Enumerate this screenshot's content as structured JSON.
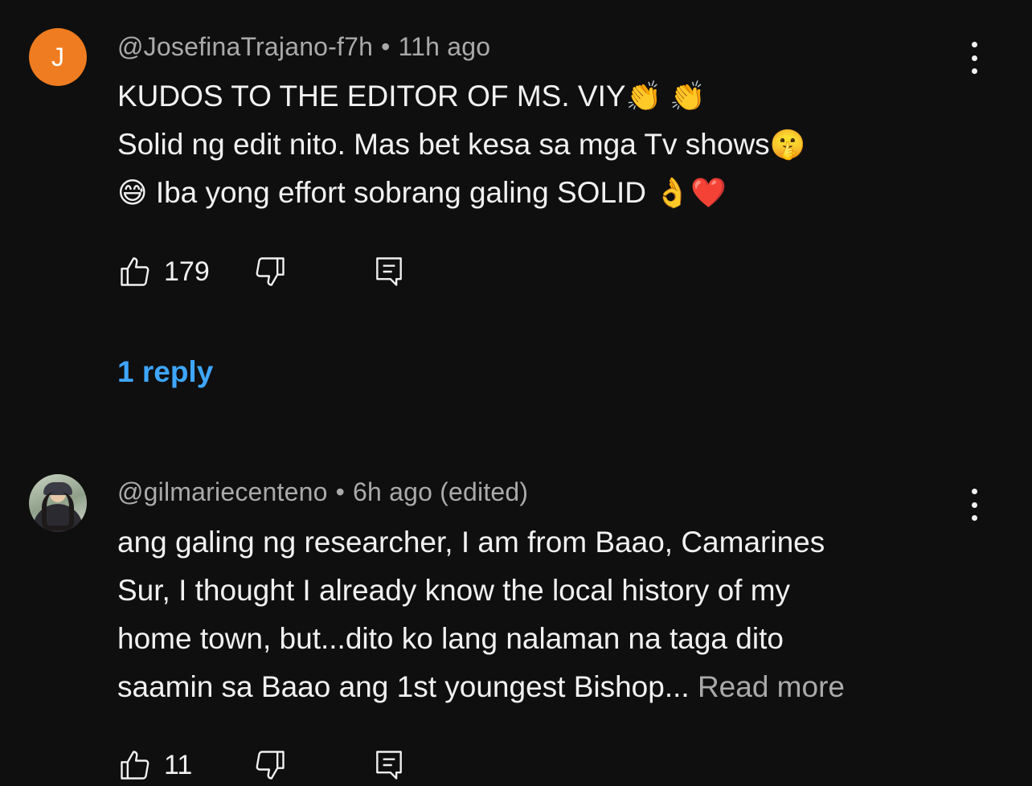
{
  "comments": [
    {
      "avatar_letter": "J",
      "avatar_color": "#ef7c20",
      "author": "@JosefinaTrajano-f7h",
      "separator": "•",
      "time": "11h ago",
      "lines": [
        {
          "text": "KUDOS TO THE EDITOR OF MS. VIY",
          "emoji": "👏 👏"
        },
        {
          "text": "Solid ng edit nito. Mas bet kesa sa mga Tv shows",
          "emoji": "🤫"
        },
        {
          "prefix_emoji": "😅",
          "text": "Iba yong effort sobrang galing SOLID",
          "emoji": "👌❤️"
        }
      ],
      "likes": "179",
      "replies_label": "1 reply"
    },
    {
      "avatar_icon": "profile-photo",
      "author": "@gilmariecenteno",
      "separator": "•",
      "time": "6h ago (edited)",
      "lines": [
        {
          "text": "ang galing ng researcher, I am from Baao, Camarines"
        },
        {
          "text": "Sur, I thought I already know the local history of my"
        },
        {
          "text": "home town, but...dito ko lang nalaman na taga dito"
        },
        {
          "text": "saamin sa Baao ang 1st youngest Bishop...",
          "more": "Read more"
        }
      ],
      "likes": "11"
    }
  ],
  "icons": {
    "like": "thumbs-up-icon",
    "dislike": "thumbs-down-icon",
    "reply": "comment-reply-icon",
    "menu": "more-vertical-icon"
  },
  "colors": {
    "background": "#0f0f0f",
    "text": "#f1f1f1",
    "meta": "#aaaaaa",
    "link": "#3ea6ff"
  }
}
